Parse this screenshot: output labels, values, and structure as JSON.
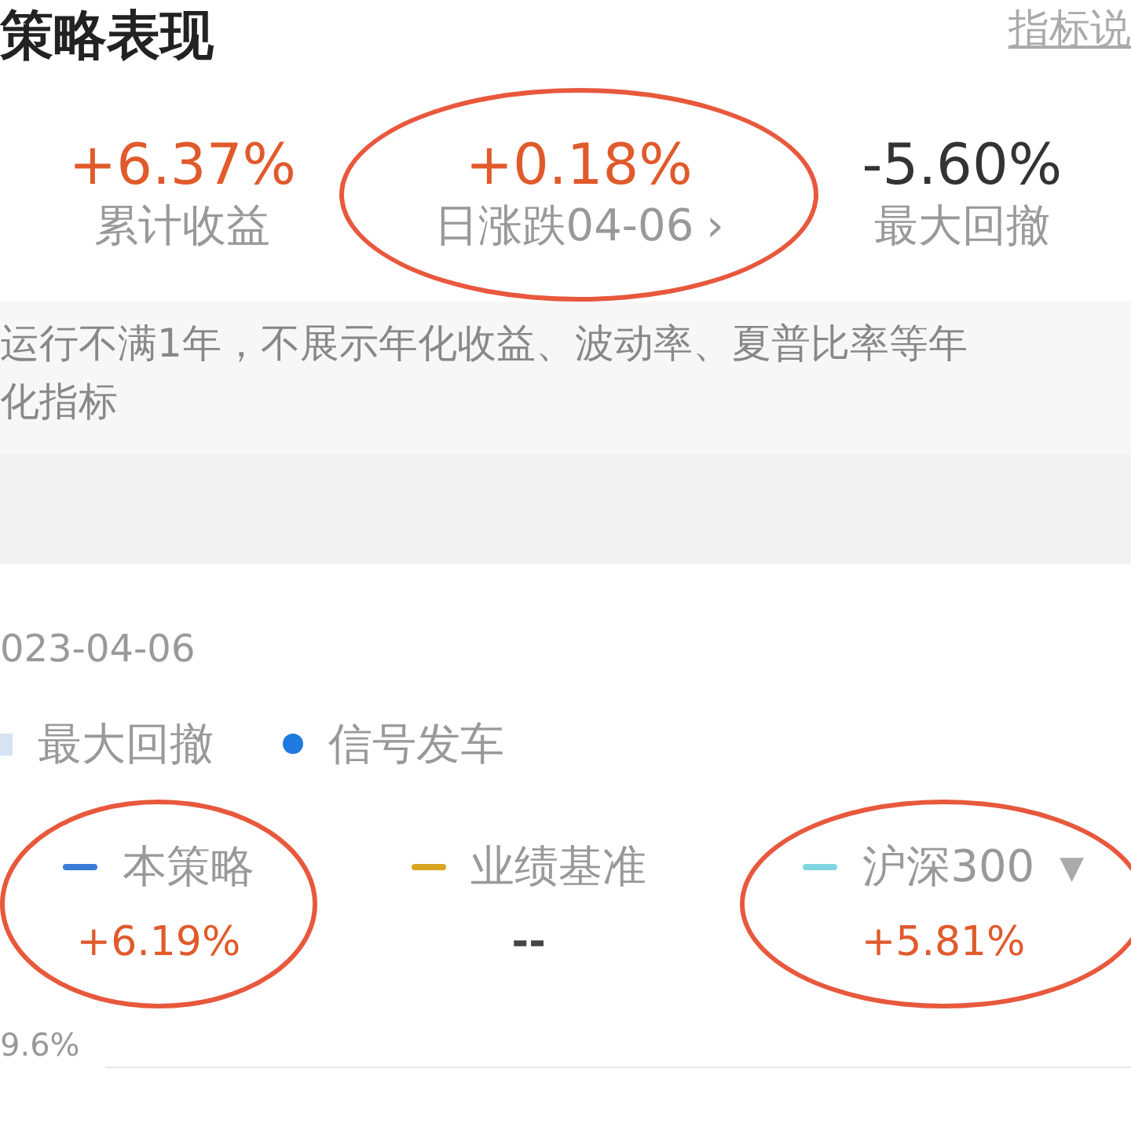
{
  "header": {
    "title": "策略表现",
    "link": "指标说"
  },
  "metrics": [
    {
      "value": "+6.37%",
      "label": "累计收益",
      "color": "#e05a2b",
      "circled": false
    },
    {
      "value": "+0.18%",
      "label": "日涨跌04-06",
      "color": "#e05a2b",
      "chevron": "›",
      "circled": true
    },
    {
      "value": "-5.60%",
      "label": "最大回撤",
      "color": "#333333",
      "circled": false
    }
  ],
  "note": "运行不满1年，不展示年化收益、波动率、夏普比率等年化指标",
  "chart": {
    "date": "023-04-06",
    "legend": [
      {
        "label": "最大回撤",
        "kind": "square",
        "color": "#d6e4f5"
      },
      {
        "label": "信号发车",
        "kind": "dot",
        "color": "#1f7ae0"
      }
    ],
    "series": [
      {
        "name": "本策略",
        "color": "#3a7bd5",
        "value": "+6.19%",
        "positive": true,
        "circled": true
      },
      {
        "name": "业绩基准",
        "color": "#d9a520",
        "value": "--",
        "positive": false,
        "circled": false
      },
      {
        "name": "沪深300",
        "color": "#7fd6e0",
        "value": "+5.81%",
        "positive": true,
        "dropdown": "▼",
        "circled": true
      }
    ],
    "axis_label": "9.6%"
  }
}
